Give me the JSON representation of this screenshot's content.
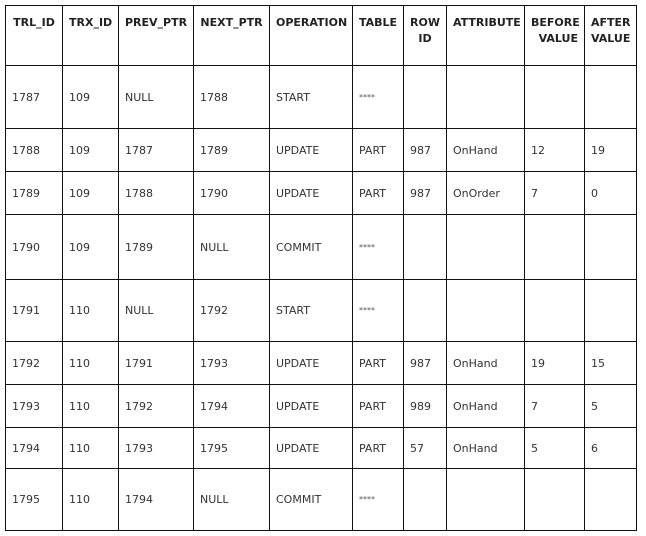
{
  "table": {
    "headers": [
      "TRL_ID",
      "TRX_ID",
      "PREV_PTR",
      "NEXT_PTR",
      "OPERATION",
      "TABLE",
      "ROW ID",
      "ATTRIBUTE",
      "BEFORE VALUE",
      "AFTER VALUE"
    ],
    "rows": [
      [
        "1787",
        "109",
        "NULL",
        "1788",
        "START",
        "****",
        "",
        "",
        "",
        ""
      ],
      [
        "1788",
        "109",
        "1787",
        "1789",
        "UPDATE",
        "PART",
        "987",
        "OnHand",
        "12",
        "19"
      ],
      [
        "1789",
        "109",
        "1788",
        "1790",
        "UPDATE",
        "PART",
        "987",
        "OnOrder",
        "7",
        "0"
      ],
      [
        "1790",
        "109",
        "1789",
        "NULL",
        "COMMIT",
        "****",
        "",
        "",
        "",
        ""
      ],
      [
        "1791",
        "110",
        "NULL",
        "1792",
        "START",
        "****",
        "",
        "",
        "",
        ""
      ],
      [
        "1792",
        "110",
        "1791",
        "1793",
        "UPDATE",
        "PART",
        "987",
        "OnHand",
        "19",
        "15"
      ],
      [
        "1793",
        "110",
        "1792",
        "1794",
        "UPDATE",
        "PART",
        "989",
        "OnHand",
        "7",
        "5"
      ],
      [
        "1794",
        "110",
        "1793",
        "1795",
        "UPDATE",
        "PART",
        "57",
        "OnHand",
        "5",
        "6"
      ],
      [
        "1795",
        "110",
        "1794",
        "NULL",
        "COMMIT",
        "****",
        "",
        "",
        "",
        ""
      ]
    ]
  }
}
